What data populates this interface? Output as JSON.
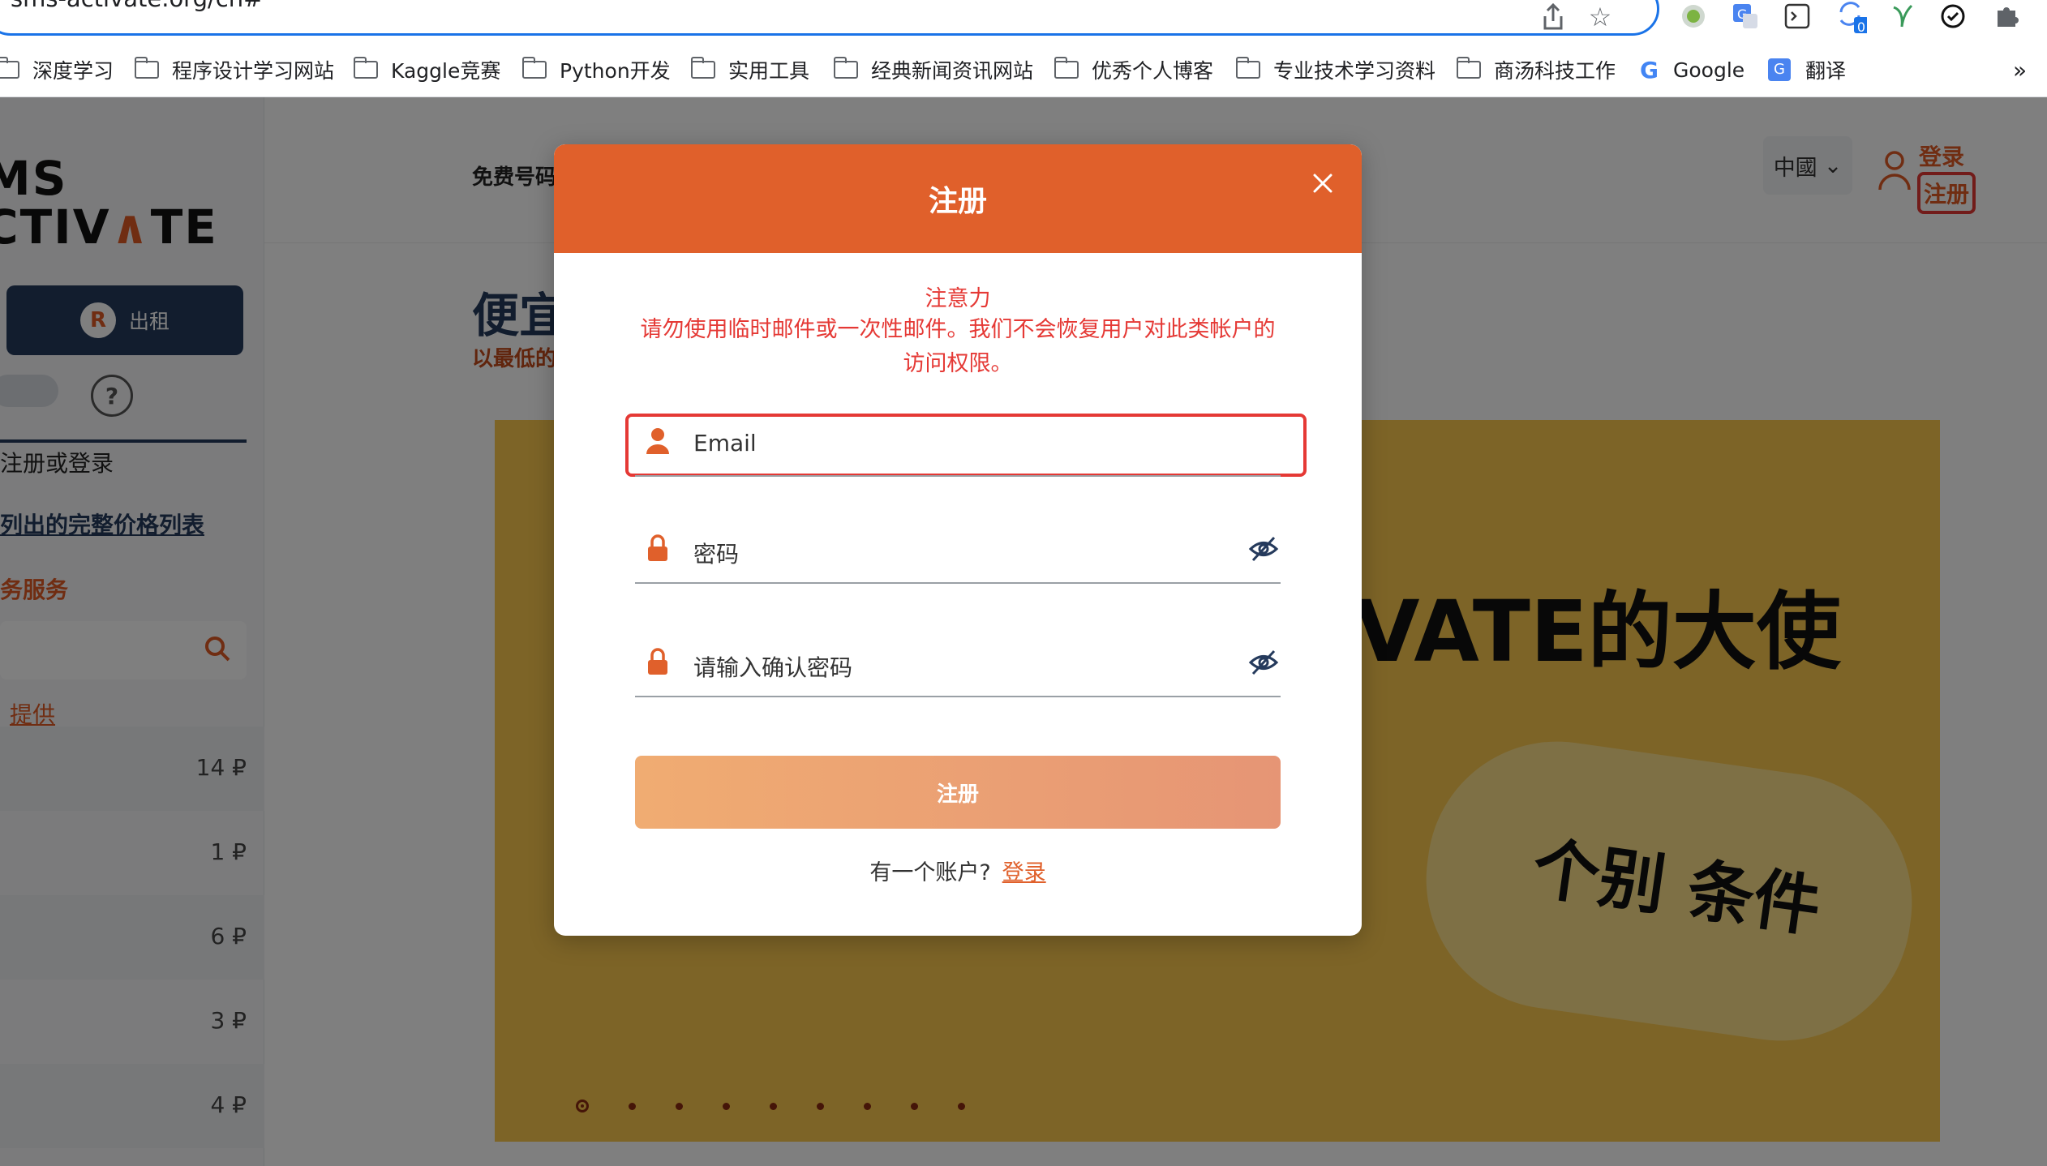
{
  "browser": {
    "url": "sms-activate.org/cn#",
    "extensions": [
      "share-icon",
      "star-icon",
      "green-circle-extension-icon",
      "translate-extension-icon",
      "terminal-extension-icon",
      "sync-extension-icon",
      "leaf-extension-icon",
      "check-circle-extension-icon",
      "puzzle-extensions-icon"
    ],
    "extension_badge": "0",
    "bookmarks": [
      {
        "label": "深度学习",
        "icon": "folder-icon"
      },
      {
        "label": "程序设计学习网站",
        "icon": "folder-icon"
      },
      {
        "label": "Kaggle竞赛",
        "icon": "folder-icon"
      },
      {
        "label": "Python开发",
        "icon": "folder-icon"
      },
      {
        "label": "实用工具",
        "icon": "folder-icon"
      },
      {
        "label": "经典新闻资讯网站",
        "icon": "folder-icon"
      },
      {
        "label": "优秀个人博客",
        "icon": "folder-icon"
      },
      {
        "label": "专业技术学习资料",
        "icon": "folder-icon"
      },
      {
        "label": "商汤科技工作",
        "icon": "folder-icon"
      },
      {
        "label": "Google",
        "icon": "google-icon"
      },
      {
        "label": "翻译",
        "icon": "translate-icon"
      }
    ],
    "bookmarks_overflow": "»"
  },
  "site": {
    "logo_line1": "MS",
    "logo_line2_a": "CTIV",
    "logo_line2_b": "TE",
    "rent_button": "出租",
    "help": "?",
    "sidebar_login": "注册或登录",
    "price_list_link": "列出的完整价格列表",
    "services_heading": "务服务",
    "offer_link": "提供",
    "service_rows": [
      {
        "price": "14 ₽"
      },
      {
        "price": "1 ₽"
      },
      {
        "price": "6 ₽"
      },
      {
        "price": "3 ₽"
      },
      {
        "price": "4 ₽"
      }
    ],
    "nav_free_numbers": "免费号码",
    "region": "中國",
    "top_login": "登录",
    "top_register": "注册",
    "headline": "便宜",
    "subline": "以最低的",
    "banner_title": "VATE的大使",
    "banner_sub": "个别 条件",
    "banner_dot_count": 9,
    "banner_active_dot": 0
  },
  "modal": {
    "title": "注册",
    "warning_title": "注意力",
    "warning_text": "请勿使用临时邮件或一次性邮件。我们不会恢复用户对此类帐户的访问权限。",
    "email_placeholder": "Email",
    "password_placeholder": "密码",
    "confirm_placeholder": "请输入确认密码",
    "submit_label": "注册",
    "have_account": "有一个账户?",
    "login_link": "登录"
  },
  "colors": {
    "accent": "#e0602b",
    "warning": "#e53935",
    "navy": "#253a5c",
    "button_start": "#f0ac72",
    "button_end": "#e69575"
  }
}
